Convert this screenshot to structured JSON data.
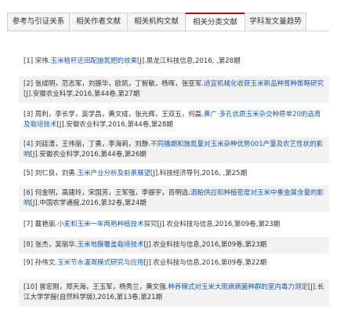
{
  "tabs": [
    {
      "label": "参考与引证关系",
      "active": false
    },
    {
      "label": "相关作者文献",
      "active": false
    },
    {
      "label": "相关机构文献",
      "active": false
    },
    {
      "label": "相关分类文献",
      "active": true
    },
    {
      "label": "学科发文量趋势",
      "active": false
    }
  ],
  "items": [
    {
      "pre": "[1] 宋伟.",
      "title": "玉米秸秆还田配施氮肥的效果",
      "post": "[J].黑龙江科技信息,2016, ,第28期"
    },
    {
      "pre": "[2] 张成明，范志军，刘振华，欧凯，丁智敏，杨晖，张亚军.",
      "title": "适宜机械化收获玉米新品种育种策略研究",
      "post": "[J].安徽农业科学,2016,第44卷,第27期"
    },
    {
      "pre": "[3] 周利，李长学，吴学昌，黄文成，张光辉，王双五，何磊.",
      "title": "黄广·多孔优质玉米杂交种原单20的选育及栽培技术",
      "post": "[J].安徽农业科学,2016,第44卷,第28期"
    },
    {
      "pre": "[4] 刘廷清，王伟丽，丁勇，李海莉，刘静.",
      "title": "不同播期和施氮量对玉米杂种优势001产量及农艺性状的影响",
      "post": "[J].安徽农业科学,2016,第44卷,第26期"
    },
    {
      "pre": "[5] 刘仁良，刘勇.",
      "title": "玉米产业分析及前景展望",
      "post": "[J].科技经济导刊,2016, ,第25期"
    },
    {
      "pre": "[6] 何金明，高建玲，宋国芳，王军强，李振宇，百明选.",
      "title": "酒粕供应和种植密度对玉米中重金属含量的影响",
      "post": "[J].中国农学通报,2016,第32卷,第24期"
    },
    {
      "pre": "[7] 戴艳丽.",
      "title": "小麦和玉米一年两熟种植技术探究",
      "post": "[J].农业科技与信息,2016,第09卷,第23期"
    },
    {
      "pre": "[8] 张杰，吴丽华.",
      "title": "玉米地膜覆盖栽培技术",
      "post": "[J].农业科技与信息,2016,第09卷,第23期"
    },
    {
      "pre": "[9] 孙伟文.",
      "title": "玉米节水灌溉模式研究与应用",
      "post": "[J].农业科技与信息,2016,第09卷,第22期"
    },
    {
      "pre": "[10] 曾宏刚，郑天海，王玉军，杨秀兰，黄文强.",
      "title": "种养模式对玉米大斑病病菌种群的室内毒力测定",
      "post": "[J].长江大学学报(自然科学版),2016,第13卷,第21期"
    }
  ]
}
